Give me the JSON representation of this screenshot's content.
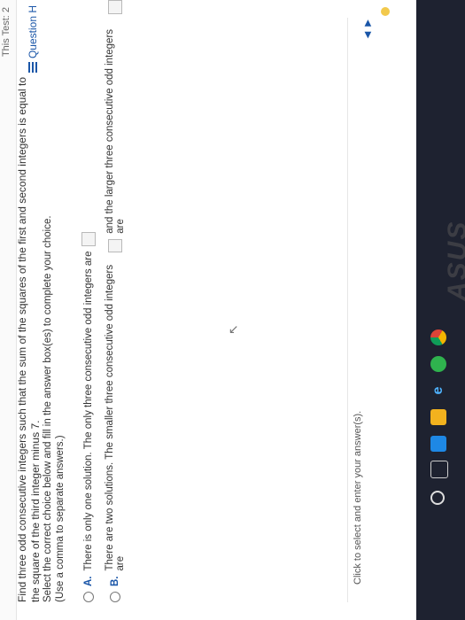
{
  "header": {
    "top_right": "This Test: 2",
    "question_help": "Question H"
  },
  "problem": {
    "text": "Find three odd consecutive integers such that the sum of the squares of the first and second integers is equal to the square of the third integer minus 7.",
    "instruction": "Select the correct choice below and fill in the answer box(es) to complete your choice.",
    "note": "(Use a comma to separate answers.)"
  },
  "choices": [
    {
      "letter": "A.",
      "text": "There is only one solution. The only three consecutive odd integers are"
    },
    {
      "letter": "B.",
      "text_1": "There are two solutions. The smaller three consecutive odd integers are",
      "text_2": "and the larger three consecutive odd integers are"
    }
  ],
  "footer": {
    "hint": "Click to select and enter your answer(s)."
  },
  "taskbar": {
    "icons": [
      "start-icon",
      "task-view-icon",
      "edge-icon",
      "folder-icon",
      "ie-icon",
      "green-app-icon",
      "chrome-icon"
    ]
  },
  "bezel": {
    "logo": "ASUS"
  }
}
